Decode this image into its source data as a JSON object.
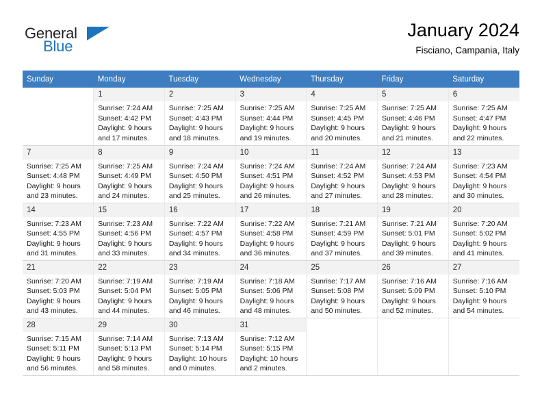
{
  "brand": {
    "name_part1": "General",
    "name_part2": "Blue",
    "color_primary": "#1c75bc",
    "color_text": "#231f20",
    "triangle_icon": "triangle-icon"
  },
  "header": {
    "title": "January 2024",
    "subtitle": "Fisciano, Campania, Italy"
  },
  "theme": {
    "header_row_bg": "#3d7dc0",
    "daynum_bg": "#f2f2f2",
    "grid_line": "#e0e0e0"
  },
  "weekdays": [
    "Sunday",
    "Monday",
    "Tuesday",
    "Wednesday",
    "Thursday",
    "Friday",
    "Saturday"
  ],
  "weeks": [
    [
      {
        "day": "",
        "lines": []
      },
      {
        "day": "1",
        "lines": [
          "Sunrise: 7:24 AM",
          "Sunset: 4:42 PM",
          "Daylight: 9 hours",
          "and 17 minutes."
        ]
      },
      {
        "day": "2",
        "lines": [
          "Sunrise: 7:25 AM",
          "Sunset: 4:43 PM",
          "Daylight: 9 hours",
          "and 18 minutes."
        ]
      },
      {
        "day": "3",
        "lines": [
          "Sunrise: 7:25 AM",
          "Sunset: 4:44 PM",
          "Daylight: 9 hours",
          "and 19 minutes."
        ]
      },
      {
        "day": "4",
        "lines": [
          "Sunrise: 7:25 AM",
          "Sunset: 4:45 PM",
          "Daylight: 9 hours",
          "and 20 minutes."
        ]
      },
      {
        "day": "5",
        "lines": [
          "Sunrise: 7:25 AM",
          "Sunset: 4:46 PM",
          "Daylight: 9 hours",
          "and 21 minutes."
        ]
      },
      {
        "day": "6",
        "lines": [
          "Sunrise: 7:25 AM",
          "Sunset: 4:47 PM",
          "Daylight: 9 hours",
          "and 22 minutes."
        ]
      }
    ],
    [
      {
        "day": "7",
        "lines": [
          "Sunrise: 7:25 AM",
          "Sunset: 4:48 PM",
          "Daylight: 9 hours",
          "and 23 minutes."
        ]
      },
      {
        "day": "8",
        "lines": [
          "Sunrise: 7:25 AM",
          "Sunset: 4:49 PM",
          "Daylight: 9 hours",
          "and 24 minutes."
        ]
      },
      {
        "day": "9",
        "lines": [
          "Sunrise: 7:24 AM",
          "Sunset: 4:50 PM",
          "Daylight: 9 hours",
          "and 25 minutes."
        ]
      },
      {
        "day": "10",
        "lines": [
          "Sunrise: 7:24 AM",
          "Sunset: 4:51 PM",
          "Daylight: 9 hours",
          "and 26 minutes."
        ]
      },
      {
        "day": "11",
        "lines": [
          "Sunrise: 7:24 AM",
          "Sunset: 4:52 PM",
          "Daylight: 9 hours",
          "and 27 minutes."
        ]
      },
      {
        "day": "12",
        "lines": [
          "Sunrise: 7:24 AM",
          "Sunset: 4:53 PM",
          "Daylight: 9 hours",
          "and 28 minutes."
        ]
      },
      {
        "day": "13",
        "lines": [
          "Sunrise: 7:23 AM",
          "Sunset: 4:54 PM",
          "Daylight: 9 hours",
          "and 30 minutes."
        ]
      }
    ],
    [
      {
        "day": "14",
        "lines": [
          "Sunrise: 7:23 AM",
          "Sunset: 4:55 PM",
          "Daylight: 9 hours",
          "and 31 minutes."
        ]
      },
      {
        "day": "15",
        "lines": [
          "Sunrise: 7:23 AM",
          "Sunset: 4:56 PM",
          "Daylight: 9 hours",
          "and 33 minutes."
        ]
      },
      {
        "day": "16",
        "lines": [
          "Sunrise: 7:22 AM",
          "Sunset: 4:57 PM",
          "Daylight: 9 hours",
          "and 34 minutes."
        ]
      },
      {
        "day": "17",
        "lines": [
          "Sunrise: 7:22 AM",
          "Sunset: 4:58 PM",
          "Daylight: 9 hours",
          "and 36 minutes."
        ]
      },
      {
        "day": "18",
        "lines": [
          "Sunrise: 7:21 AM",
          "Sunset: 4:59 PM",
          "Daylight: 9 hours",
          "and 37 minutes."
        ]
      },
      {
        "day": "19",
        "lines": [
          "Sunrise: 7:21 AM",
          "Sunset: 5:01 PM",
          "Daylight: 9 hours",
          "and 39 minutes."
        ]
      },
      {
        "day": "20",
        "lines": [
          "Sunrise: 7:20 AM",
          "Sunset: 5:02 PM",
          "Daylight: 9 hours",
          "and 41 minutes."
        ]
      }
    ],
    [
      {
        "day": "21",
        "lines": [
          "Sunrise: 7:20 AM",
          "Sunset: 5:03 PM",
          "Daylight: 9 hours",
          "and 43 minutes."
        ]
      },
      {
        "day": "22",
        "lines": [
          "Sunrise: 7:19 AM",
          "Sunset: 5:04 PM",
          "Daylight: 9 hours",
          "and 44 minutes."
        ]
      },
      {
        "day": "23",
        "lines": [
          "Sunrise: 7:19 AM",
          "Sunset: 5:05 PM",
          "Daylight: 9 hours",
          "and 46 minutes."
        ]
      },
      {
        "day": "24",
        "lines": [
          "Sunrise: 7:18 AM",
          "Sunset: 5:06 PM",
          "Daylight: 9 hours",
          "and 48 minutes."
        ]
      },
      {
        "day": "25",
        "lines": [
          "Sunrise: 7:17 AM",
          "Sunset: 5:08 PM",
          "Daylight: 9 hours",
          "and 50 minutes."
        ]
      },
      {
        "day": "26",
        "lines": [
          "Sunrise: 7:16 AM",
          "Sunset: 5:09 PM",
          "Daylight: 9 hours",
          "and 52 minutes."
        ]
      },
      {
        "day": "27",
        "lines": [
          "Sunrise: 7:16 AM",
          "Sunset: 5:10 PM",
          "Daylight: 9 hours",
          "and 54 minutes."
        ]
      }
    ],
    [
      {
        "day": "28",
        "lines": [
          "Sunrise: 7:15 AM",
          "Sunset: 5:11 PM",
          "Daylight: 9 hours",
          "and 56 minutes."
        ]
      },
      {
        "day": "29",
        "lines": [
          "Sunrise: 7:14 AM",
          "Sunset: 5:13 PM",
          "Daylight: 9 hours",
          "and 58 minutes."
        ]
      },
      {
        "day": "30",
        "lines": [
          "Sunrise: 7:13 AM",
          "Sunset: 5:14 PM",
          "Daylight: 10 hours",
          "and 0 minutes."
        ]
      },
      {
        "day": "31",
        "lines": [
          "Sunrise: 7:12 AM",
          "Sunset: 5:15 PM",
          "Daylight: 10 hours",
          "and 2 minutes."
        ]
      },
      {
        "day": "",
        "lines": []
      },
      {
        "day": "",
        "lines": []
      },
      {
        "day": "",
        "lines": []
      }
    ]
  ]
}
